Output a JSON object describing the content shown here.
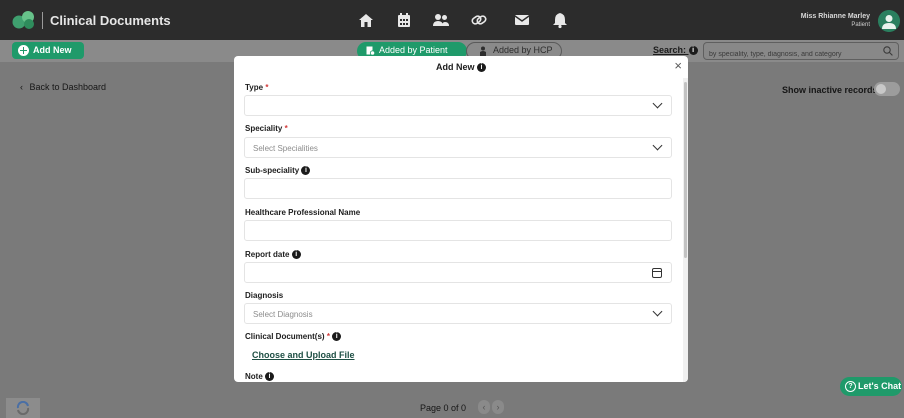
{
  "app": {
    "title": "Clinical Documents"
  },
  "user": {
    "name": "Miss Rhianne Marley",
    "role": "Patient"
  },
  "nav_icons": [
    "home-icon",
    "calendar-icon",
    "users-icon",
    "link-icon",
    "mail-icon",
    "bell-icon"
  ],
  "toolbar": {
    "add_new_label": "Add New",
    "tab_patient_label": "Added by Patient",
    "tab_hcp_label": "Added by HCP",
    "search_label": "Search:",
    "search_placeholder": "by speciality, type, diagnosis, and category"
  },
  "page": {
    "back_label": "Back to Dashboard",
    "show_inactive_label": "Show inactive records",
    "pagination_label": "Page 0 of 0",
    "chat_label": "Let's Chat"
  },
  "modal": {
    "title": "Add New",
    "fields": {
      "type_label": "Type",
      "speciality_label": "Speciality",
      "speciality_placeholder": "Select Specialities",
      "subspeciality_label": "Sub-speciality",
      "hcp_name_label": "Healthcare Professional Name",
      "report_date_label": "Report date",
      "diagnosis_label": "Diagnosis",
      "diagnosis_placeholder": "Select Diagnosis",
      "clinical_docs_label": "Clinical Document(s)",
      "upload_label": "Choose and Upload File",
      "note_label": "Note"
    },
    "required_mark": "*",
    "info_mark": "i",
    "close_symbol": "×"
  },
  "colors": {
    "accent": "#1f9a6a",
    "topbar": "#2c2c2c",
    "overlay": "#7a7a7a"
  }
}
